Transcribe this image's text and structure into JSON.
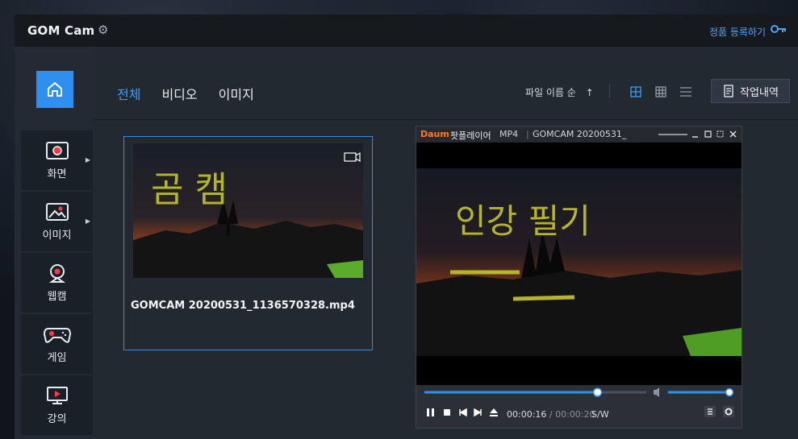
{
  "app": {
    "logo_main": "GOM",
    "logo_sub": "Cam",
    "register_label": "정품 등록하기"
  },
  "sidebar": {
    "items": [
      {
        "label": "화면",
        "icon": "screen-record-icon"
      },
      {
        "label": "이미지",
        "icon": "image-icon"
      },
      {
        "label": "웹캠",
        "icon": "webcam-icon"
      },
      {
        "label": "게임",
        "icon": "gamepad-icon"
      },
      {
        "label": "강의",
        "icon": "lecture-icon"
      }
    ]
  },
  "tabs": [
    {
      "label": "전체",
      "active": true
    },
    {
      "label": "비디오"
    },
    {
      "label": "이미지"
    }
  ],
  "toolbar": {
    "sort_label": "파일 이름 순",
    "sort_arrow": "↑",
    "history_label": "작업내역"
  },
  "files": [
    {
      "name": "GOMCAM 20200531_1136570328.mp4",
      "type": "video",
      "thumb_text": "곰 캠"
    }
  ],
  "player": {
    "brand": "팟플레이어",
    "format": "MP4",
    "title": "GOMCAM 20200531_",
    "video_text_line1": "인강 필기",
    "current_time": "00:00:16",
    "total_time": "00:00:20",
    "mode": "S/W",
    "progress": 0.78,
    "volume": 1.0
  },
  "colors": {
    "accent": "#2f8ff0",
    "register": "#4aa3ff",
    "handwriting": "#b5b52a"
  }
}
